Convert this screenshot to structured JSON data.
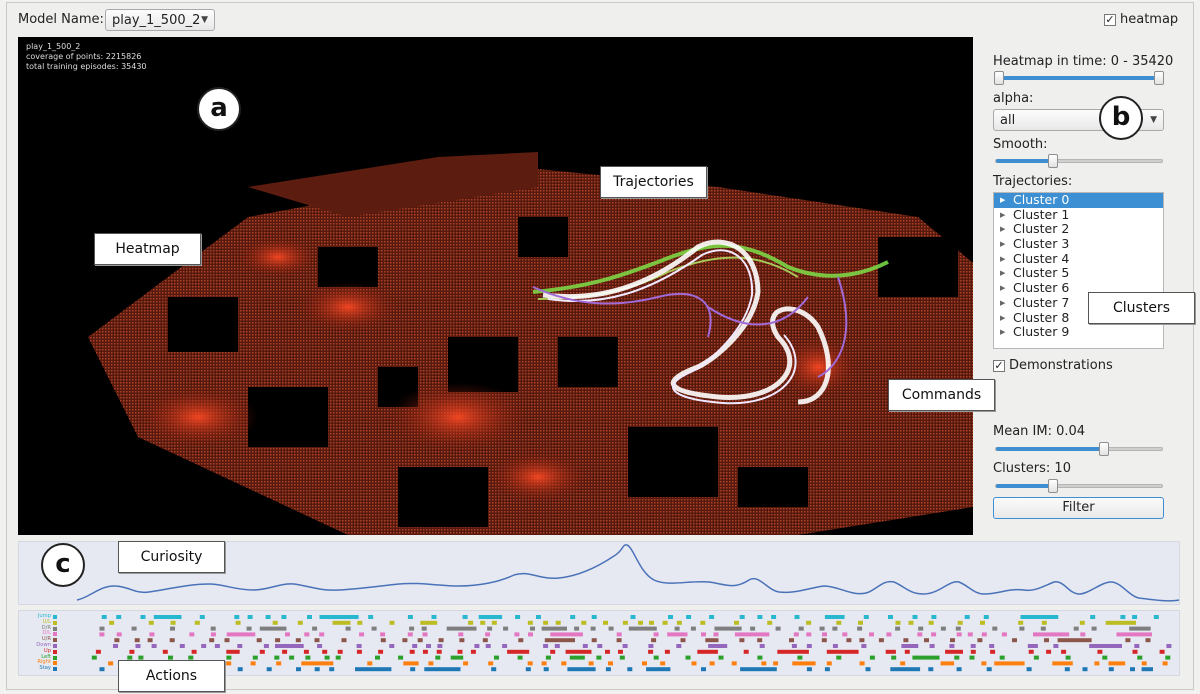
{
  "topbar": {
    "model_label": "Model Name:",
    "model_value": "play_1_500_2",
    "heatmap_checkbox": "heatmap",
    "heatmap_checked": "✓"
  },
  "viewport": {
    "info_lines": [
      "play_1_500_2",
      "coverage of points: 2215826",
      "total training episodes: 35430"
    ]
  },
  "panel": {
    "heatmap_time_label": "Heatmap in time: 0 - 35420",
    "heatmap_time_range": [
      0.0,
      1.0
    ],
    "alpha_label": "alpha:",
    "alpha_value": "all",
    "smooth_label": "Smooth:",
    "smooth_level": 0.34,
    "trajectories_label": "Trajectories:",
    "clusters": [
      "Cluster 0",
      "Cluster 1",
      "Cluster 2",
      "Cluster 3",
      "Cluster 4",
      "Cluster 5",
      "Cluster 6",
      "Cluster 7",
      "Cluster 8",
      "Cluster 9"
    ],
    "selected_cluster": "Cluster 0",
    "demonstrations_label": "Demonstrations",
    "demonstrations_checked": "✓",
    "mean_im_label": "Mean IM: 0.04",
    "mean_im_level": 0.64,
    "clusters_label": "Clusters: 10",
    "clusters_level": 0.34,
    "filter_button": "Filter"
  },
  "callouts": {
    "a": "a",
    "b": "b",
    "c": "c",
    "trajectories": "Trajectories",
    "heatmap": "Heatmap",
    "clusters": "Clusters",
    "commands": "Commands",
    "curiosity": "Curiosity",
    "actions": "Actions"
  },
  "actions": {
    "labels": [
      "Jump",
      "U/L",
      "D/R",
      "D/L",
      "U/R",
      "Down",
      "Up",
      "Left",
      "Right",
      "Stay"
    ],
    "colors": [
      "#27b7cf",
      "#bcbd22",
      "#7f7f7f",
      "#e377c2",
      "#8c564b",
      "#9467bd",
      "#d62728",
      "#2ca02c",
      "#ff7f0e",
      "#1f77b4"
    ]
  },
  "colors": {
    "accent": "#3b8fd2",
    "curve": "#4a72b8",
    "traj_green": "#7ee04a",
    "traj_purple": "#a06ad8"
  }
}
